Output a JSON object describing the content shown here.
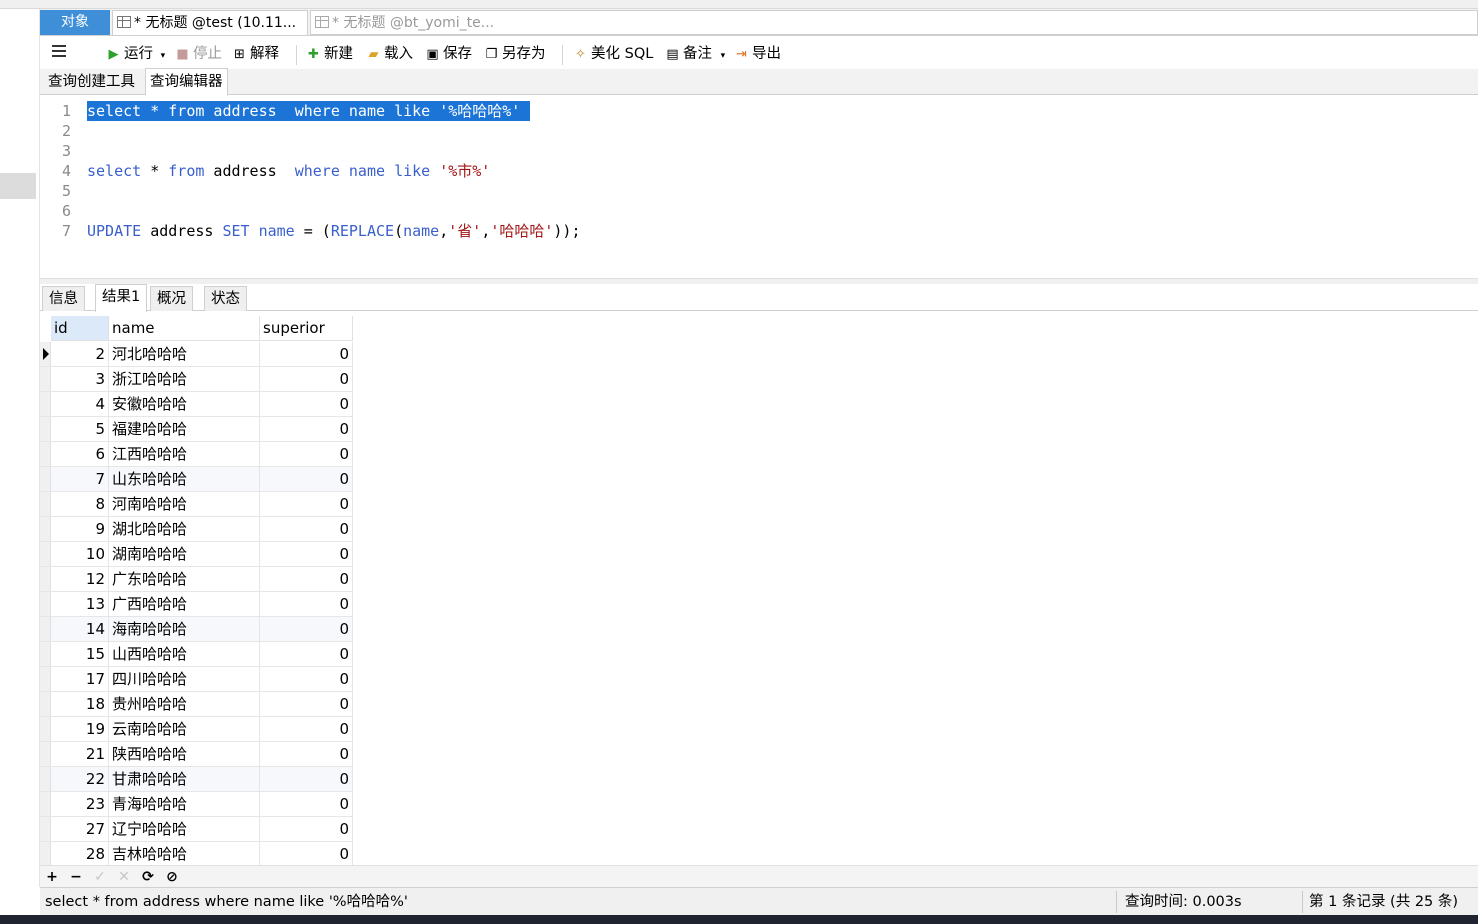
{
  "tabs": {
    "objects": "对象",
    "query1": "* 无标题 @test (10.11...",
    "query2": "* 无标题 @bt_yomi_te..."
  },
  "toolbar": {
    "run": "运行",
    "stop": "停止",
    "explain": "解释",
    "new": "新建",
    "load": "载入",
    "save": "保存",
    "save_as": "另存为",
    "beautify": "美化 SQL",
    "comment": "备注",
    "export": "导出"
  },
  "subtabs": {
    "builder": "查询创建工具",
    "editor": "查询编辑器"
  },
  "editor": {
    "line_numbers": [
      "1",
      "2",
      "3",
      "4",
      "5",
      "6",
      "7"
    ],
    "line1": {
      "k1": "select",
      "t1": " * ",
      "k2": "from",
      "t2": " address  ",
      "k3": "where",
      "t3": " ",
      "k4": "name",
      "t4": " ",
      "k5": "like",
      "t5": " ",
      "s1": "'%哈哈哈%'"
    },
    "line4": {
      "k1": "select",
      "t1": " * ",
      "k2": "from",
      "t2": " address  ",
      "k3": "where",
      "t3": " ",
      "k4": "name",
      "t4": " ",
      "k5": "like",
      "t5": " ",
      "s1": "'%市%'"
    },
    "line7": {
      "k1": "UPDATE",
      "t1": " address ",
      "k2": "SET",
      "t2": " ",
      "k3": "name",
      "t3": " = (",
      "k4": "REPLACE",
      "t4": "(",
      "k5": "name",
      "t5": ",",
      "s1": "'省'",
      "t6": ",",
      "s2": "'哈哈哈'",
      "t7": "));"
    }
  },
  "result_tabs": [
    "信息",
    "结果1",
    "概况",
    "状态"
  ],
  "grid": {
    "columns": [
      "id",
      "name",
      "superior"
    ],
    "rows": [
      [
        "2",
        "河北哈哈哈",
        "0"
      ],
      [
        "3",
        "浙江哈哈哈",
        "0"
      ],
      [
        "4",
        "安徽哈哈哈",
        "0"
      ],
      [
        "5",
        "福建哈哈哈",
        "0"
      ],
      [
        "6",
        "江西哈哈哈",
        "0"
      ],
      [
        "7",
        "山东哈哈哈",
        "0"
      ],
      [
        "8",
        "河南哈哈哈",
        "0"
      ],
      [
        "9",
        "湖北哈哈哈",
        "0"
      ],
      [
        "10",
        "湖南哈哈哈",
        "0"
      ],
      [
        "12",
        "广东哈哈哈",
        "0"
      ],
      [
        "13",
        "广西哈哈哈",
        "0"
      ],
      [
        "14",
        "海南哈哈哈",
        "0"
      ],
      [
        "15",
        "山西哈哈哈",
        "0"
      ],
      [
        "17",
        "四川哈哈哈",
        "0"
      ],
      [
        "18",
        "贵州哈哈哈",
        "0"
      ],
      [
        "19",
        "云南哈哈哈",
        "0"
      ],
      [
        "21",
        "陕西哈哈哈",
        "0"
      ],
      [
        "22",
        "甘肃哈哈哈",
        "0"
      ],
      [
        "23",
        "青海哈哈哈",
        "0"
      ],
      [
        "27",
        "辽宁哈哈哈",
        "0"
      ],
      [
        "28",
        "吉林哈哈哈",
        "0"
      ]
    ]
  },
  "nav": {
    "add": "+",
    "remove": "−",
    "apply": "✓",
    "discard": "✕",
    "refresh": "⟳",
    "stop": "⊘"
  },
  "status": {
    "sql": "select * from address  where name like '%哈哈哈%'",
    "query_time": "查询时间: 0.003s",
    "record": "第 1 条记录 (共 25 条)"
  },
  "colors": {
    "accent": "#3f8fd8",
    "selection": "#1c75d6",
    "keyword": "#3a5fcd",
    "string": "#a31515",
    "run_icon": "#2ea02e"
  }
}
